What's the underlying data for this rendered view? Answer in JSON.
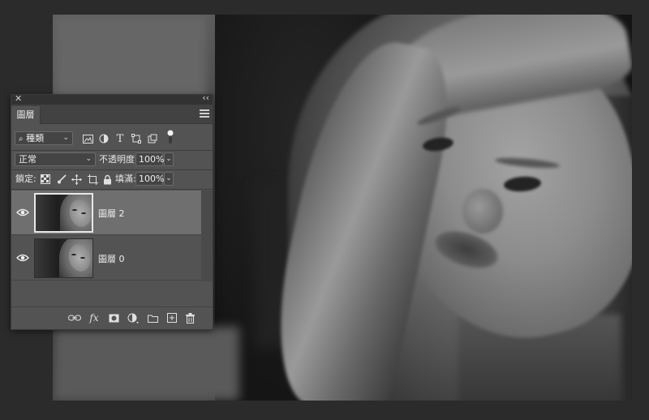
{
  "panel": {
    "title_tab": "圖層",
    "close_glyph": "✕",
    "collapse_glyph": "‹‹"
  },
  "filter": {
    "kind_label": "種類",
    "icons": [
      "image-filter-icon",
      "adjustment-filter-icon",
      "type-filter-icon",
      "shape-filter-icon",
      "smart-object-filter-icon",
      "filter-toggle-icon"
    ]
  },
  "blend": {
    "mode": "正常",
    "opacity_label": "不透明度:",
    "opacity_value": "100%"
  },
  "lock": {
    "label": "鎖定:",
    "fill_label": "填滿:",
    "fill_value": "100%"
  },
  "layers": [
    {
      "name": "圖層 2",
      "visible": true,
      "selected": true
    },
    {
      "name": "圖層 0",
      "visible": true,
      "selected": false
    }
  ],
  "footer": {
    "fx_label": "fx"
  },
  "colors": {
    "panel_bg": "#535353",
    "selected_layer_bg": "#6f6f6f",
    "app_bg": "#2b2b2b"
  }
}
